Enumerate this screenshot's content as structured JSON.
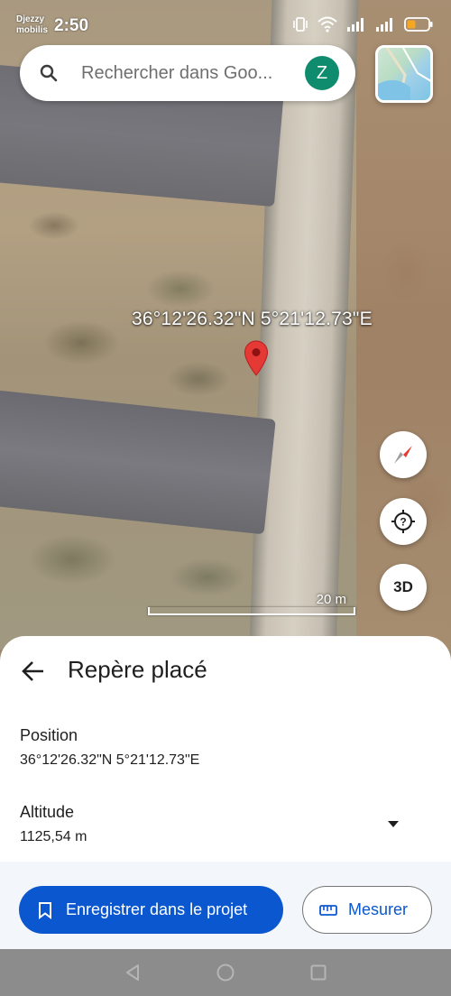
{
  "status_bar": {
    "carrier_line1": "Djezzy",
    "carrier_line2": "mobilis",
    "time": "2:50",
    "battery_color": "#f5a623"
  },
  "search": {
    "placeholder": "Rechercher dans Goo...",
    "avatar_letter": "Z",
    "avatar_color": "#0f8c6e"
  },
  "map": {
    "pin_coordinates": "36°12'26.32\"N 5°21'12.73\"E",
    "three_d_label": "3D",
    "scale_label": "20 m",
    "icons": [
      "search-icon",
      "compass-icon",
      "help-location-icon",
      "map-layer-thumbnail"
    ]
  },
  "sheet": {
    "title": "Repère placé",
    "position_label": "Position",
    "position_value": "36°12'26.32\"N 5°21'12.73\"E",
    "altitude_label": "Altitude",
    "altitude_value": "1125,54 m",
    "save_button": "Enregistrer dans le projet",
    "measure_button": "Mesurer",
    "accent_color": "#0b57d0"
  }
}
